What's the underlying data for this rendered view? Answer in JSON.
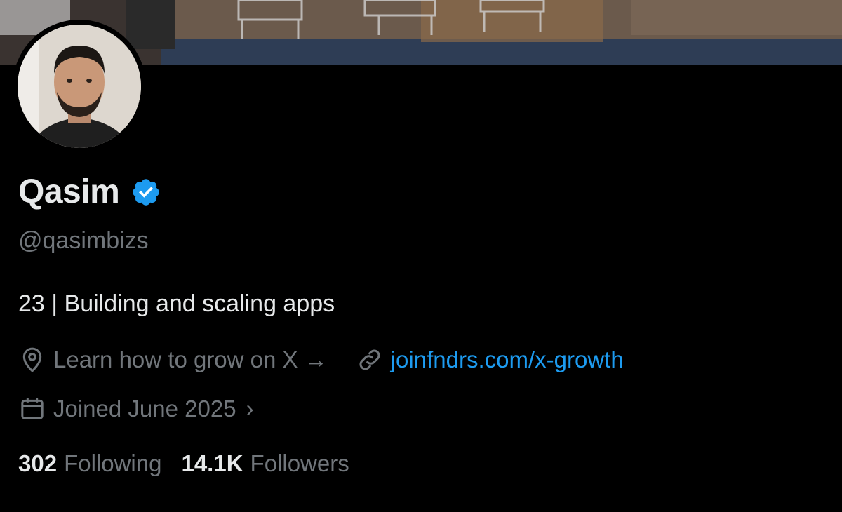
{
  "profile": {
    "name": "Qasim",
    "handle": "@qasimbizs",
    "bio": "23 | Building and scaling apps",
    "location": "Learn how to grow on X →",
    "website": "joinfndrs.com/x-growth",
    "joined": "Joined June 2025",
    "joined_chevron": "›",
    "verified": true
  },
  "stats": {
    "following_count": "302",
    "following_label": "Following",
    "followers_count": "14.1K",
    "followers_label": "Followers"
  },
  "icons": {
    "verified": "verified-badge-icon",
    "location": "location-pin-icon",
    "link": "link-icon",
    "calendar": "calendar-icon"
  },
  "colors": {
    "background": "#000000",
    "primary_text": "#e7e9ea",
    "secondary_text": "#71767b",
    "link": "#1d9bf0",
    "verified": "#1d9bf0"
  }
}
